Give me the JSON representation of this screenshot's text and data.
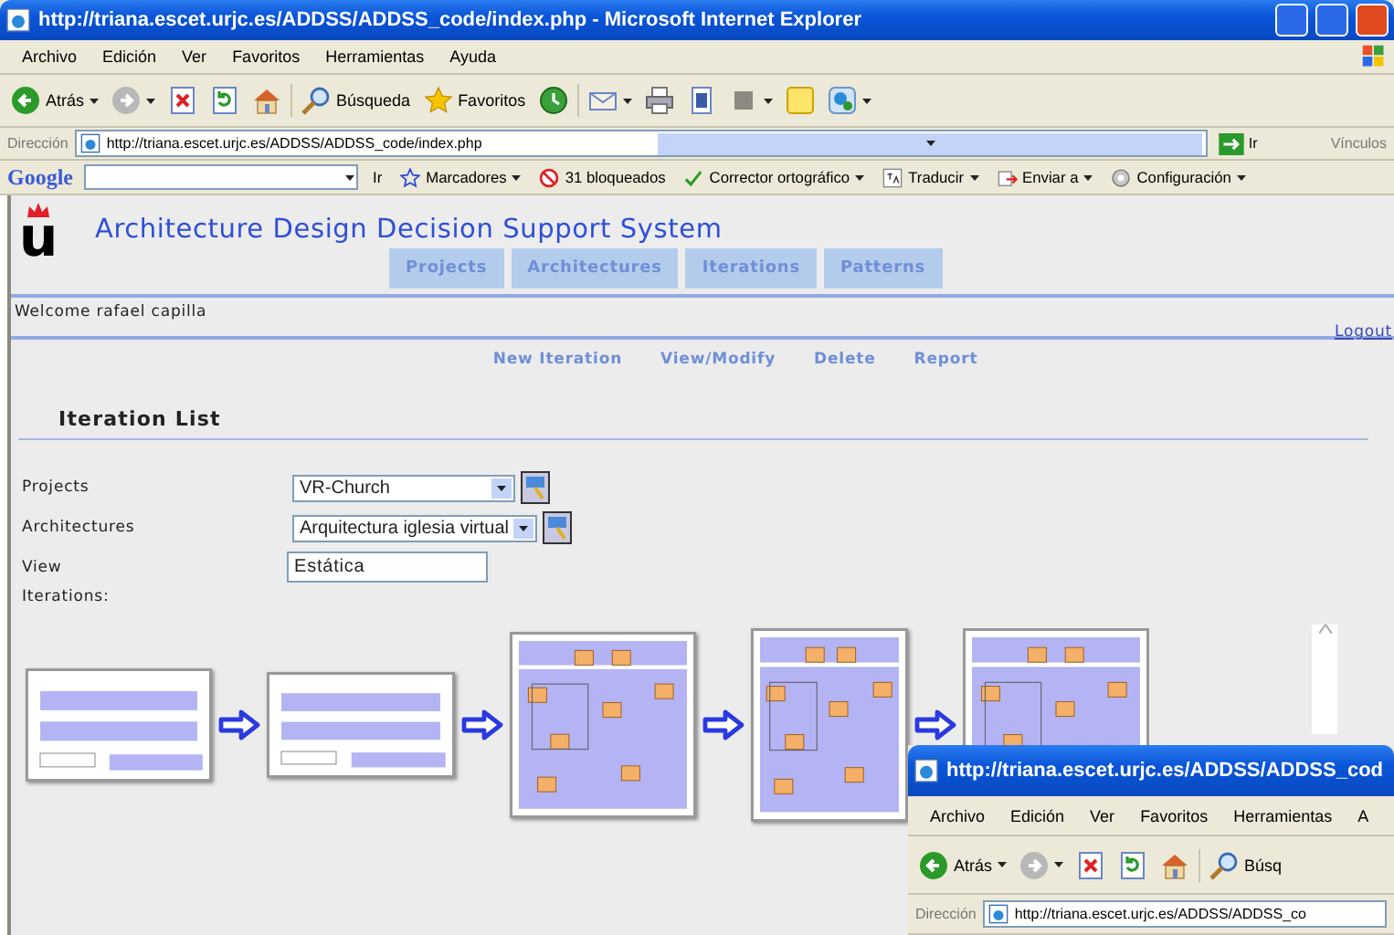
{
  "window": {
    "title": "http://triana.escet.urjc.es/ADDSS/ADDSS_code/index.php - Microsoft Internet Explorer",
    "menu": [
      "Archivo",
      "Edición",
      "Ver",
      "Favoritos",
      "Herramientas",
      "Ayuda"
    ],
    "toolbar": [
      {
        "kind": "back",
        "label": "Atrás",
        "menu": true
      },
      {
        "kind": "forward",
        "menu": true
      },
      {
        "kind": "stop"
      },
      {
        "kind": "refresh"
      },
      {
        "kind": "home"
      },
      {
        "kind": "search",
        "label": "Búsqueda"
      },
      {
        "kind": "favorites",
        "label": "Favoritos"
      },
      {
        "kind": "history"
      },
      {
        "kind": "mail",
        "menu": true
      },
      {
        "kind": "print"
      },
      {
        "kind": "edit"
      },
      {
        "kind": "discuss",
        "menu": true
      },
      {
        "kind": "notes"
      },
      {
        "kind": "messenger",
        "menu": true
      }
    ],
    "address": {
      "label": "Dirección",
      "url": "http://triana.escet.urjc.es/ADDSS/ADDSS_code/index.php",
      "go": "Ir",
      "links": "Vínculos"
    },
    "google_bar": {
      "logo": "Google",
      "items": [
        {
          "kind": "go",
          "label": "Ir"
        },
        {
          "kind": "bookmarks",
          "label": "Marcadores",
          "menu": true
        },
        {
          "kind": "blocked",
          "label": "31 bloqueados"
        },
        {
          "kind": "spell",
          "label": "Corrector ortográfico",
          "menu": true
        },
        {
          "kind": "translate",
          "label": "Traducir",
          "menu": true
        },
        {
          "kind": "send",
          "label": "Enviar a",
          "menu": true
        },
        {
          "kind": "settings",
          "label": "Configuración",
          "menu": true
        }
      ]
    }
  },
  "page": {
    "logo": "u",
    "title": "Architecture Design Decision Support System",
    "tabs": [
      {
        "label": "Projects",
        "selected": false
      },
      {
        "label": "Architectures",
        "selected": false
      },
      {
        "label": "Iterations",
        "selected": false
      },
      {
        "label": "Patterns",
        "selected": false
      }
    ],
    "welcome": "Welcome rafael capilla",
    "logout": "Logout",
    "actions": [
      "New Iteration",
      "View/Modify",
      "Delete",
      "Report"
    ],
    "section_title": "Iteration List",
    "form": [
      {
        "kind": "select",
        "label": "Projects",
        "value": "VR-Church"
      },
      {
        "kind": "select",
        "label": "Architectures",
        "value": "Arquitectura iglesia virtual"
      },
      {
        "kind": "text",
        "label": "View",
        "value": "Estática"
      }
    ],
    "iterations_label": "Iterations:",
    "iterations": [
      {
        "kind": "picture"
      },
      {
        "kind": "picture"
      },
      {
        "kind": "picture"
      },
      {
        "kind": "picture"
      },
      {
        "kind": "picture"
      }
    ]
  },
  "second_window": {
    "title": "http://triana.escet.urjc.es/ADDSS/ADDSS_cod",
    "menu": [
      "Archivo",
      "Edición",
      "Ver",
      "Favoritos",
      "Herramientas",
      "A"
    ],
    "toolbar": [
      {
        "kind": "back",
        "label": "Atrás",
        "menu": true
      },
      {
        "kind": "forward",
        "menu": true
      },
      {
        "kind": "stop"
      },
      {
        "kind": "refresh"
      },
      {
        "kind": "home"
      },
      {
        "kind": "search",
        "label": "Búsq"
      }
    ],
    "address": {
      "label": "Dirección",
      "url": "http://triana.escet.urjc.es/ADDSS/ADDSS_co"
    }
  }
}
